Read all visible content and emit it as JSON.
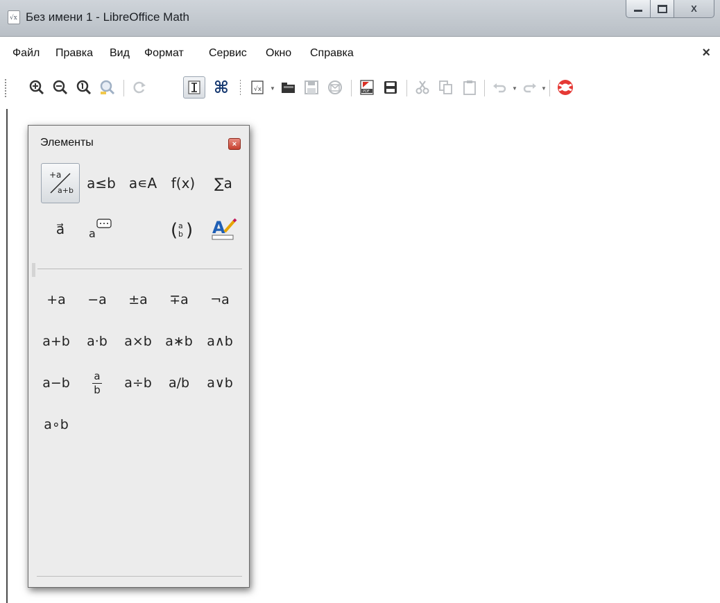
{
  "window": {
    "title": "Без имени 1 - LibreOffice Math",
    "app_icon_text": "√x"
  },
  "menu": {
    "items": [
      "Файл",
      "Правка",
      "Вид",
      "Формат",
      "Сервис",
      "Окно",
      "Справка"
    ],
    "close_glyph": "×"
  },
  "toolbar": {
    "buttons": [
      "zoom-in",
      "zoom-out",
      "zoom-100",
      "zoom-all",
      "update",
      "formula-cursor",
      "symbols",
      "new",
      "open",
      "save",
      "email",
      "export-pdf",
      "print",
      "cut",
      "copy",
      "paste",
      "undo",
      "redo",
      "help"
    ],
    "active": "formula-cursor"
  },
  "elements_panel": {
    "title": "Элементы",
    "close_glyph": "×",
    "categories": [
      "+a/a+b",
      "a≤b",
      "a∊A",
      "f(x)",
      "∑a",
      "a⃗",
      "a💬",
      "(a b)",
      "format-icon"
    ],
    "active_category": "+a/a+b",
    "items": [
      [
        "+a",
        "−a",
        "±a",
        "∓a",
        "¬a"
      ],
      [
        "a+b",
        "a·b",
        "a×b",
        "a∗b",
        "a∧b"
      ],
      [
        "a−b",
        "a/b-frac",
        "a÷b",
        "a/b",
        "a∨b"
      ],
      [
        "a∘b"
      ]
    ]
  },
  "colors": {
    "titlebar": "#c3c9cf",
    "panel_bg": "#ececec",
    "close_red": "#c6412f"
  }
}
